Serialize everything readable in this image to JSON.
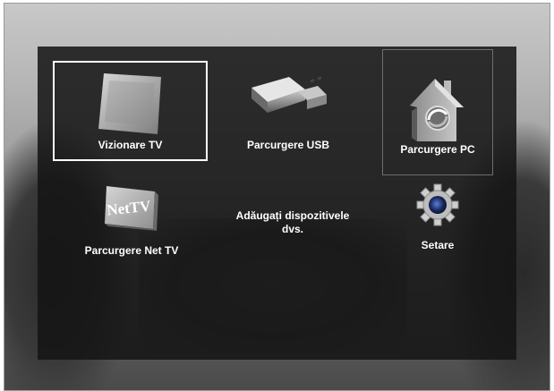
{
  "menu": {
    "items": [
      {
        "label": "Vizionare TV",
        "icon": "tv-icon",
        "selected": true
      },
      {
        "label": "Parcurgere USB",
        "icon": "usb-icon"
      },
      {
        "label": "Parcurgere PC",
        "icon": "pc-network-icon"
      },
      {
        "label": "Parcurgere Net TV",
        "icon": "net-tv-icon",
        "icon_text": "NetTV"
      },
      {
        "label": "Adăugați dispozitivele dvs.",
        "icon": "none"
      },
      {
        "label": "Setare",
        "icon": "gear-icon"
      }
    ]
  },
  "colors": {
    "panel": "#141414",
    "text": "#ffffff",
    "selection": "#ffffff"
  }
}
